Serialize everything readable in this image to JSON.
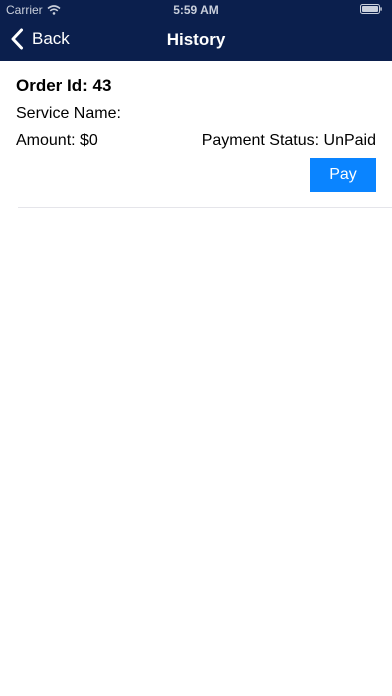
{
  "status_bar": {
    "carrier": "Carrier",
    "time": "5:59 AM"
  },
  "nav": {
    "back_label": "Back",
    "title": "History"
  },
  "colors": {
    "nav_background": "#0b1f4d",
    "pay_button": "#0a84ff"
  },
  "orders": [
    {
      "order_id": "Order Id: 43",
      "service_name": "Service Name:",
      "amount": "Amount: $0",
      "payment_status": "Payment Status: UnPaid",
      "pay_label": "Pay"
    }
  ]
}
